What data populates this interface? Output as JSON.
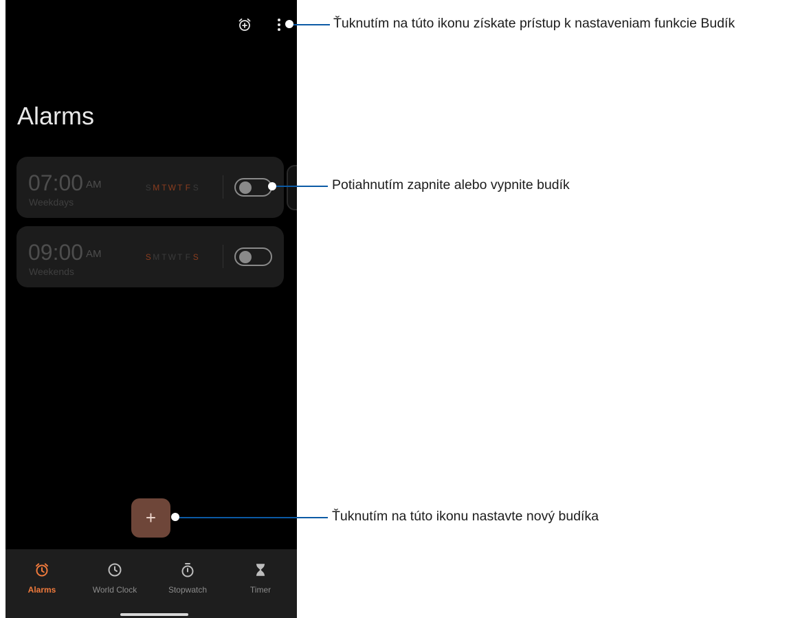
{
  "header": {
    "add_alarm_icon": "alarm-add-icon",
    "more_icon": "more-vert-icon"
  },
  "title": "Alarms",
  "alarms": [
    {
      "time": "07:00",
      "ampm": "AM",
      "label": "Weekdays",
      "days": [
        {
          "letter": "S",
          "active": false
        },
        {
          "letter": "M",
          "active": true
        },
        {
          "letter": "T",
          "active": true
        },
        {
          "letter": "W",
          "active": true
        },
        {
          "letter": "T",
          "active": true
        },
        {
          "letter": "F",
          "active": true
        },
        {
          "letter": "S",
          "active": false
        }
      ],
      "enabled": false
    },
    {
      "time": "09:00",
      "ampm": "AM",
      "label": "Weekends",
      "days": [
        {
          "letter": "S",
          "active": true
        },
        {
          "letter": "M",
          "active": false
        },
        {
          "letter": "T",
          "active": false
        },
        {
          "letter": "W",
          "active": false
        },
        {
          "letter": "T",
          "active": false
        },
        {
          "letter": "F",
          "active": false
        },
        {
          "letter": "S",
          "active": true
        }
      ],
      "enabled": false
    }
  ],
  "fab": {
    "label": "+"
  },
  "nav": {
    "items": [
      {
        "label": "Alarms",
        "icon": "alarm-icon",
        "active": true
      },
      {
        "label": "World Clock",
        "icon": "clock-icon",
        "active": false
      },
      {
        "label": "Stopwatch",
        "icon": "stopwatch-icon",
        "active": false
      },
      {
        "label": "Timer",
        "icon": "hourglass-icon",
        "active": false
      }
    ]
  },
  "callouts": [
    {
      "text": "Ťuknutím na túto ikonu získate prístup k nastaveniam funkcie Budík"
    },
    {
      "text": "Potiahnutím zapnite alebo vypnite budík"
    },
    {
      "text": "Ťuknutím na túto ikonu nastavte nový budíka"
    }
  ],
  "colors": {
    "accent": "#f07a3c",
    "active_day": "#8a3d1f",
    "fab": "#6e4639",
    "callout_line": "#0b5aa5"
  }
}
